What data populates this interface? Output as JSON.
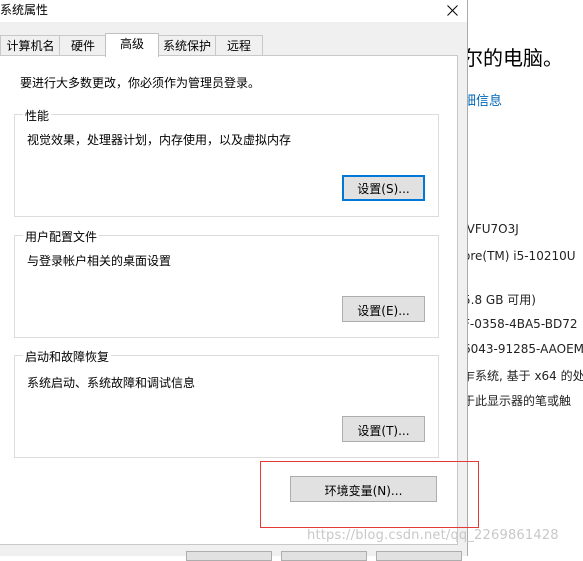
{
  "background_window": {
    "heading": "尔的电脑。",
    "link": "细信息",
    "lines": [
      "-VFU7O3J",
      "ore(TM) i5-10210U",
      "5.8 GB 可用)",
      "F-0358-4BA5-BD72",
      "6043-91285-AAOEM",
      "乍系统, 基于 x64 的处",
      "于此显示器的笔或触"
    ]
  },
  "dialog": {
    "title": "系统属性",
    "tabs": [
      "计算机名",
      "硬件",
      "高级",
      "系统保护",
      "远程"
    ],
    "active_tab": "高级",
    "admin_note": "要进行大多数更改，你必须作为管理员登录。",
    "performance": {
      "title": "性能",
      "description": "视觉效果，处理器计划，内存使用，以及虚拟内存",
      "button": "设置(S)..."
    },
    "user_profiles": {
      "title": "用户配置文件",
      "description": "与登录帐户相关的桌面设置",
      "button": "设置(E)..."
    },
    "startup_recovery": {
      "title": "启动和故障恢复",
      "description": "系统启动、系统故障和调试信息",
      "button": "设置(T)..."
    },
    "env_button": "环境变量(N)..."
  },
  "watermark": "https://blog.csdn.net/qq_2269861428",
  "colors": {
    "accent": "#0078d7",
    "highlight_box": "#e53935",
    "link": "#0067b8"
  }
}
